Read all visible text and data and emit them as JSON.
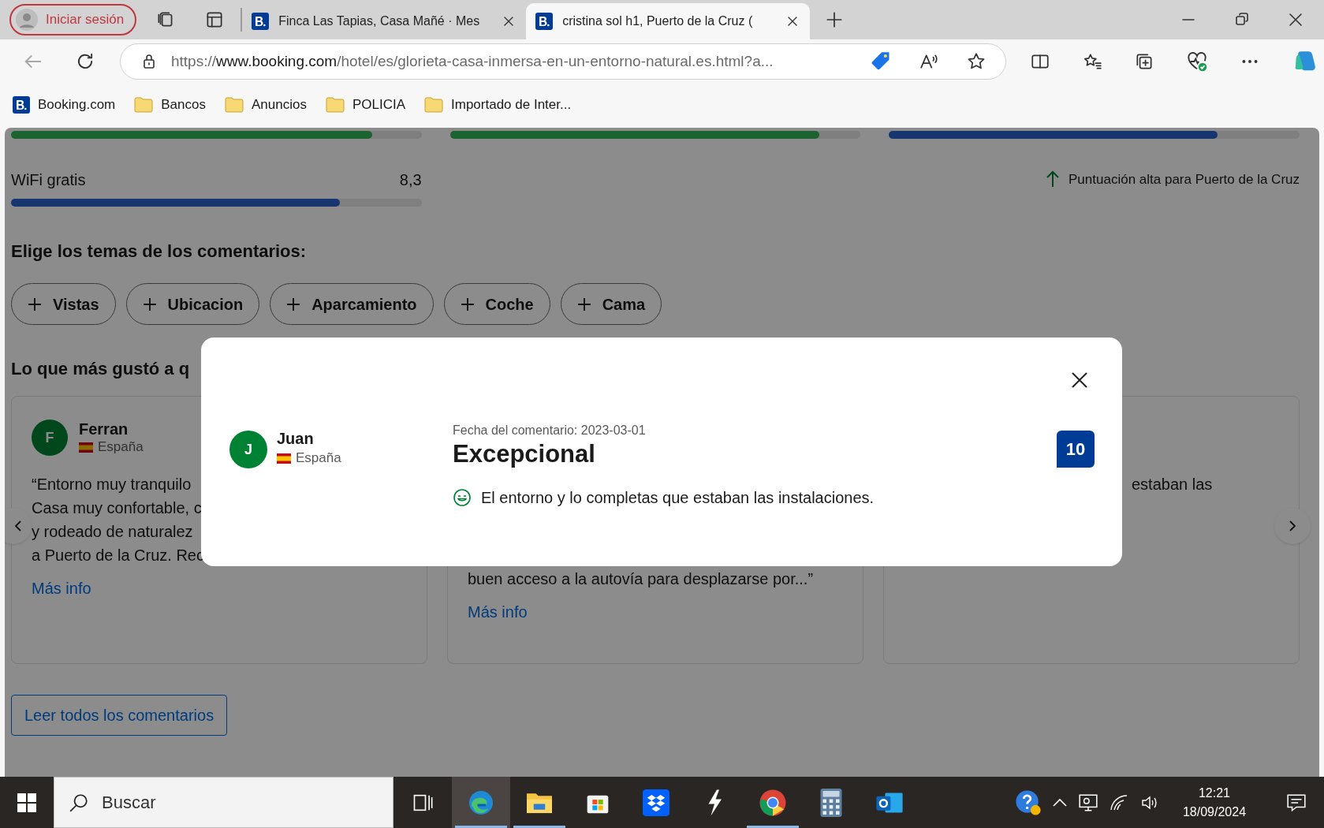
{
  "browser": {
    "profile_button": "Iniciar sesión",
    "tabs": [
      {
        "title": "Finca Las Tapias, Casa Mañé · Mes",
        "selected": false
      },
      {
        "title": "cristina sol h1, Puerto de la Cruz (",
        "selected": true
      }
    ],
    "address": {
      "scheme": "https://",
      "host": "www.booking.com",
      "path": "/hotel/es/glorieta-casa-inmersa-en-un-entorno-natural.es.html?a..."
    },
    "bookmarks": [
      {
        "kind": "site",
        "label": "Booking.com"
      },
      {
        "kind": "folder",
        "label": "Bancos"
      },
      {
        "kind": "folder",
        "label": "Anuncios"
      },
      {
        "kind": "folder",
        "label": "POLICIA"
      },
      {
        "kind": "folder",
        "label": "Importado de Inter..."
      }
    ]
  },
  "page": {
    "score_bars": [
      {
        "color": "#1c6331",
        "level": 0.88
      },
      {
        "color": "#1c6331",
        "level": 0.9
      },
      {
        "color": "#17356e",
        "level": 0.8
      }
    ],
    "wifi": {
      "label": "WiFi gratis",
      "score": "8,3",
      "level": 0.8,
      "color": "#17356e"
    },
    "highlight": "Puntuación alta para Puerto de la Cruz",
    "topics_heading": "Elige los temas de los comentarios:",
    "topics": [
      "Vistas",
      "Ubicacion",
      "Aparcamiento",
      "Coche",
      "Cama"
    ],
    "reviews_heading": "Lo que más gustó a q",
    "reviews": [
      {
        "kind": "full",
        "initial": "F",
        "name": "Ferran",
        "country": "España",
        "lines": [
          "“Entorno muy tranquilo",
          "Casa muy confortable, c",
          "y rodeado de naturalez",
          "a Puerto de la Cruz. Rec"
        ],
        "more": "Más info"
      },
      {
        "kind": "lower",
        "lines": [
          "buen acceso a la autovía para desplazarse por...”"
        ],
        "more": "Más info"
      },
      {
        "kind": "right",
        "lines": [
          "estaban las"
        ]
      }
    ],
    "read_all": "Leer todos los comentarios"
  },
  "modal": {
    "initial": "J",
    "name": "Juan",
    "country": "España",
    "date": "Fecha del comentario: 2023-03-01",
    "title": "Excepcional",
    "score": "10",
    "positive": "El entorno y lo completas que estaban las instalaciones."
  },
  "taskbar": {
    "search_placeholder": "Buscar",
    "apps": [
      {
        "kind": "edge",
        "running": true,
        "selected": true
      },
      {
        "kind": "explorer",
        "running": true,
        "selected": false
      },
      {
        "kind": "store",
        "running": false,
        "selected": false
      },
      {
        "kind": "dropbox",
        "running": false,
        "selected": false
      },
      {
        "kind": "bolt",
        "running": false,
        "selected": false
      },
      {
        "kind": "chrome",
        "running": true,
        "selected": false
      },
      {
        "kind": "calculator",
        "running": false,
        "selected": false
      },
      {
        "kind": "outlook",
        "running": false,
        "selected": false
      }
    ],
    "time": "12:21",
    "date": "18/09/2024"
  }
}
